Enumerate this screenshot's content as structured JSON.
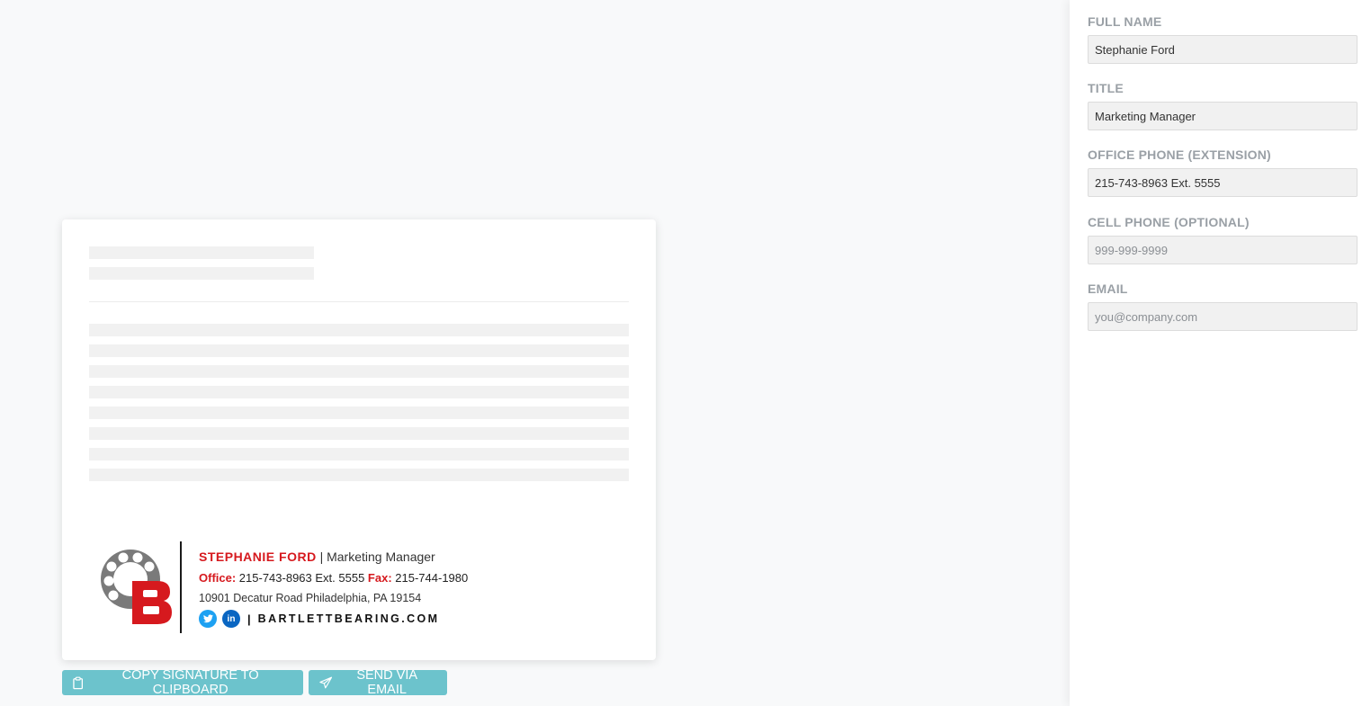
{
  "signature": {
    "name": "STEPHANIE FORD",
    "separator": "|",
    "title": "Marketing Manager",
    "office_label": "Office:",
    "office_value": "215-743-8963 Ext. 5555",
    "fax_label": "Fax:",
    "fax_value": "215-744-1980",
    "address": "10901 Decatur Road Philadelphia, PA 19154",
    "twitter_glyph": "t",
    "linkedin_glyph": "in",
    "website": "BARTLETTBEARING.COM"
  },
  "buttons": {
    "copy_label": "COPY SIGNATURE TO CLIPBOARD",
    "send_label": "SEND VIA EMAIL"
  },
  "form": {
    "full_name": {
      "label": "FULL NAME",
      "value": "Stephanie Ford",
      "placeholder": ""
    },
    "title": {
      "label": "TITLE",
      "value": "Marketing Manager",
      "placeholder": ""
    },
    "office_phone": {
      "label": "OFFICE PHONE (EXTENSION)",
      "value": "215-743-8963 Ext. 5555",
      "placeholder": ""
    },
    "cell_phone": {
      "label": "CELL PHONE (OPTIONAL)",
      "value": "",
      "placeholder": "999-999-9999"
    },
    "email": {
      "label": "EMAIL",
      "value": "",
      "placeholder": "you@company.com"
    }
  },
  "icons": {
    "copy": "clipboard-icon",
    "send": "paper-plane-icon",
    "twitter": "twitter-icon",
    "linkedin": "linkedin-icon",
    "logo": "bartlett-bearing-logo"
  },
  "colors": {
    "brand_red": "#d6191e",
    "button_teal": "#6cc3cc",
    "twitter_blue": "#1da1f2",
    "linkedin_blue": "#0a66c2"
  }
}
